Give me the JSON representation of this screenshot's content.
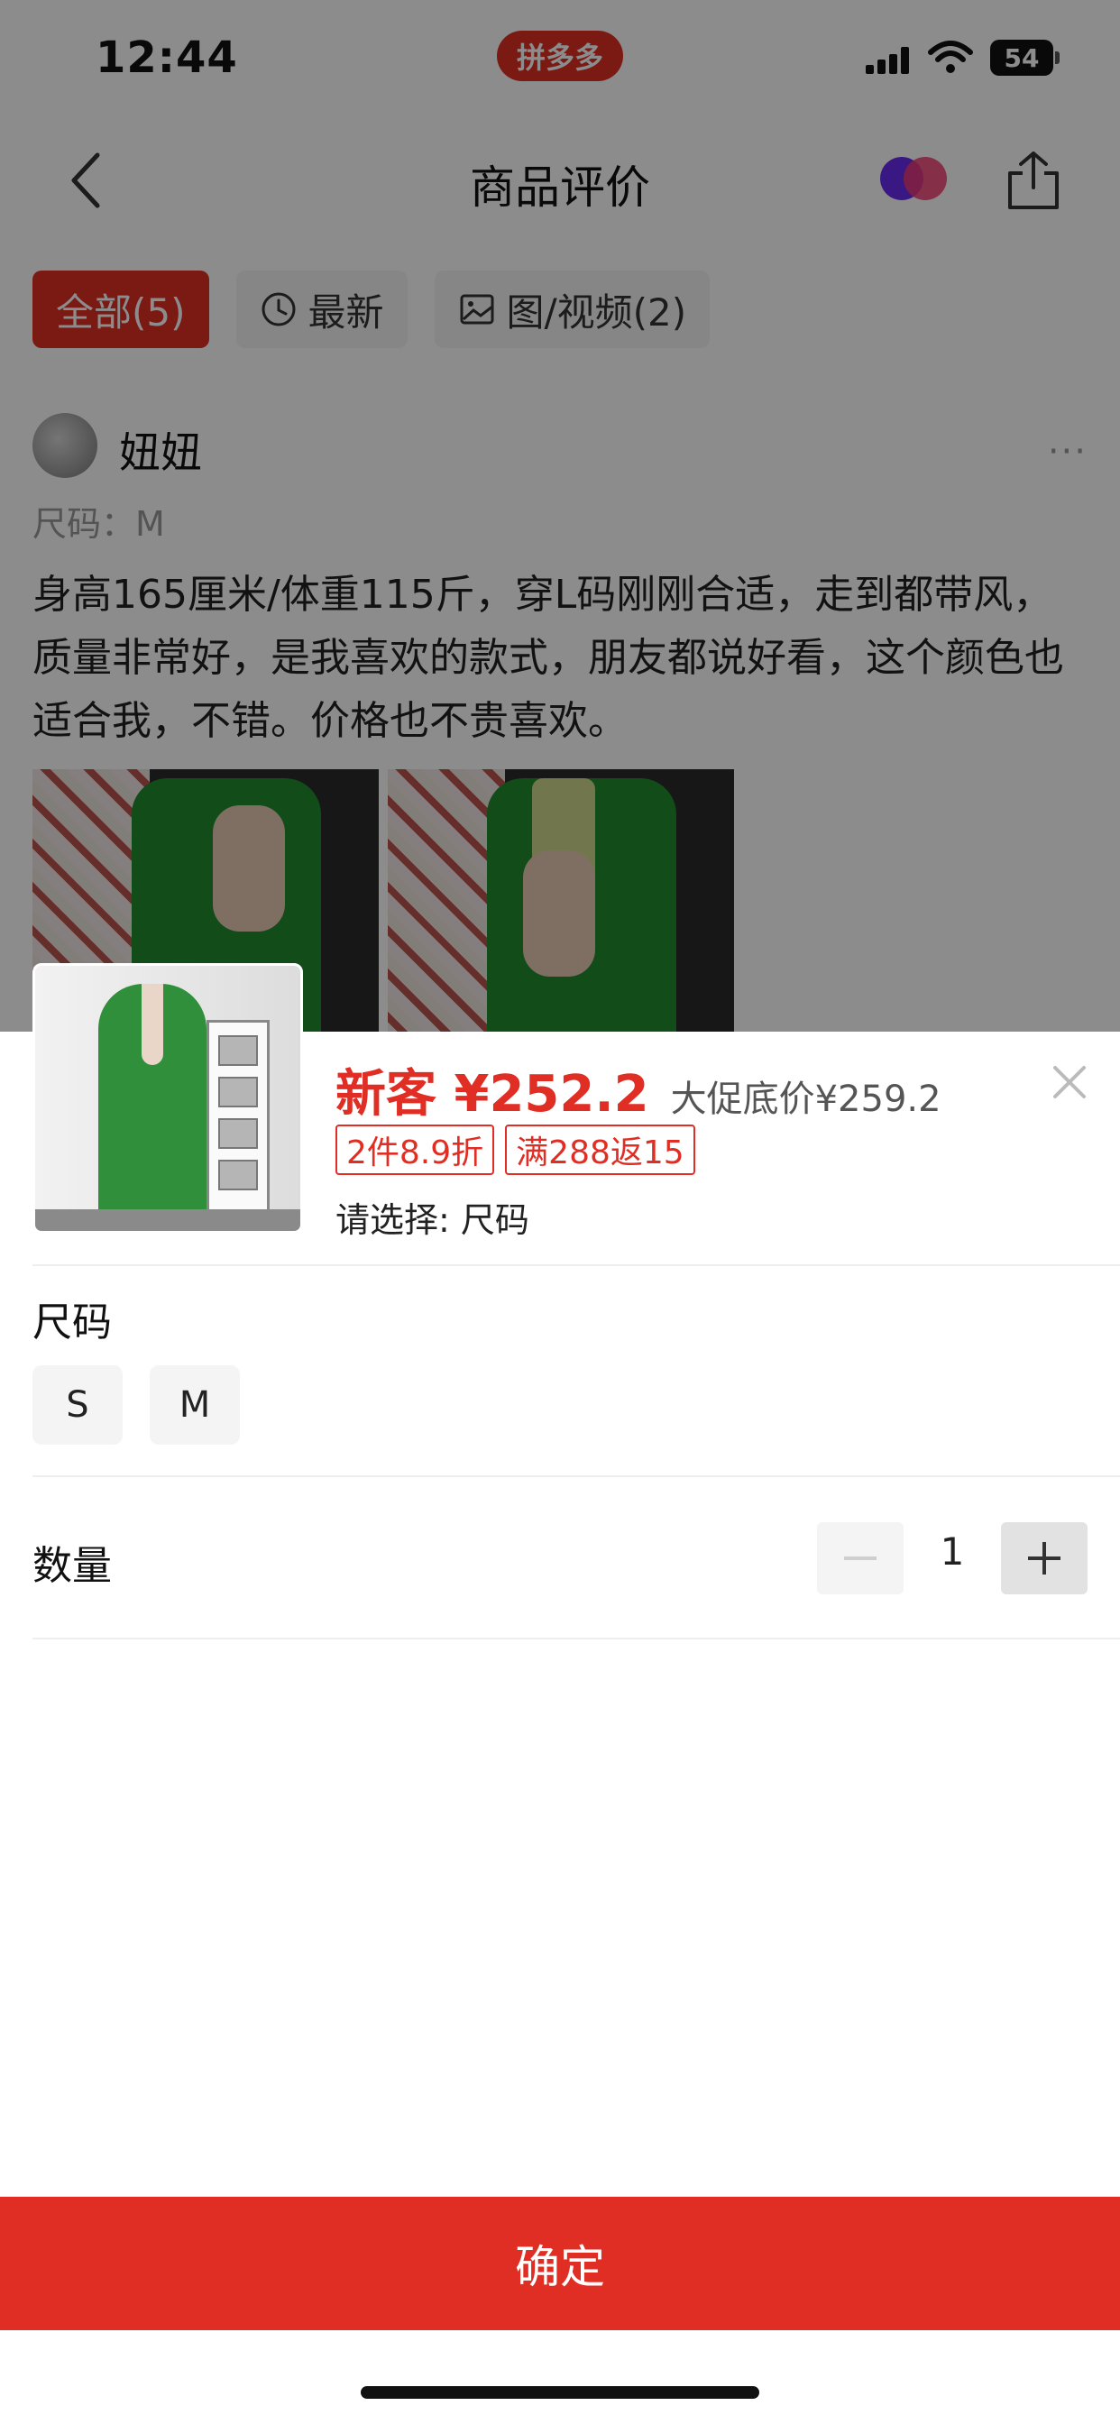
{
  "status_bar": {
    "time": "12:44",
    "app_badge": "拼多多",
    "battery": "54"
  },
  "nav": {
    "title": "商品评价"
  },
  "filters": [
    {
      "label": "全部(5)",
      "active": true
    },
    {
      "label": "最新",
      "icon": "clock-icon"
    },
    {
      "label": "图/视频(2)",
      "icon": "image-icon"
    }
  ],
  "review": {
    "name": "妞妞",
    "spec": "尺码：M",
    "text": "身高165厘米/体重115斤，穿L码刚刚合适，走到都带风，质量非常好，是我喜欢的款式，朋友都说好看，这个颜色也适合我，不错。价格也不贵喜欢。",
    "photo_count": 2
  },
  "sheet": {
    "new_price": "新客 ¥252.2",
    "promo_price": "大促底价¥259.2",
    "tags": [
      "2件8.9折",
      "满288返15"
    ],
    "choose_hint": "请选择: 尺码",
    "size_title": "尺码",
    "sizes": [
      "S",
      "M"
    ],
    "quantity_label": "数量",
    "quantity": "1",
    "confirm_label": "确定"
  },
  "colors": {
    "brand_red": "#e02e24",
    "coat_green": "#2f8f3a"
  }
}
